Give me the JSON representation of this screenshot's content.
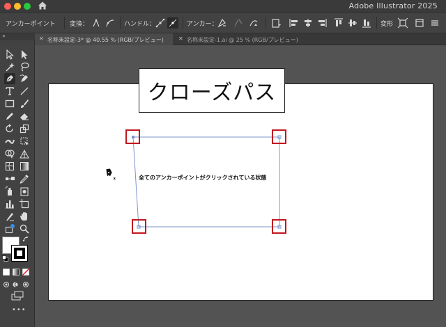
{
  "window": {
    "app_title": "Adobe Illustrator 2025"
  },
  "controlbar": {
    "selection_label": "アンカーポイント",
    "convert_label": "変換：",
    "handle_label": "ハンドル：",
    "anchor_label": "アンカー：",
    "transform_label": "変形"
  },
  "tabs": [
    {
      "label": "名称未設定-3* @ 40.55 % (RGB/プレビュー)",
      "active": true
    },
    {
      "label": "名称未設定-1.ai @ 25 % (RGB/プレビュー)",
      "active": false
    }
  ],
  "canvas": {
    "title": "クローズパス",
    "caption": "全てのアンカーポイントがクリックされている状態",
    "highlight_color": "#c3161e",
    "path_color": "#7a95c9"
  },
  "toolbar": {
    "more_label": "•••"
  },
  "icons": [
    "home-icon",
    "pen-tool-icon",
    "selection-tool-icon",
    "direct-selection-tool-icon",
    "type-tool-icon",
    "line-tool-icon",
    "rectangle-tool-icon",
    "paintbrush-icon",
    "pencil-icon",
    "eraser-icon",
    "rotate-icon",
    "scale-icon",
    "width-tool-icon",
    "free-transform-icon",
    "shape-builder-icon",
    "perspective-grid-icon",
    "mesh-icon",
    "gradient-icon",
    "eyedropper-icon",
    "blend-icon",
    "symbol-sprayer-icon",
    "column-graph-icon",
    "artboard-tool-icon",
    "slice-tool-icon",
    "hand-tool-icon",
    "zoom-tool-icon",
    "swap-colors-icon",
    "default-colors-icon"
  ]
}
